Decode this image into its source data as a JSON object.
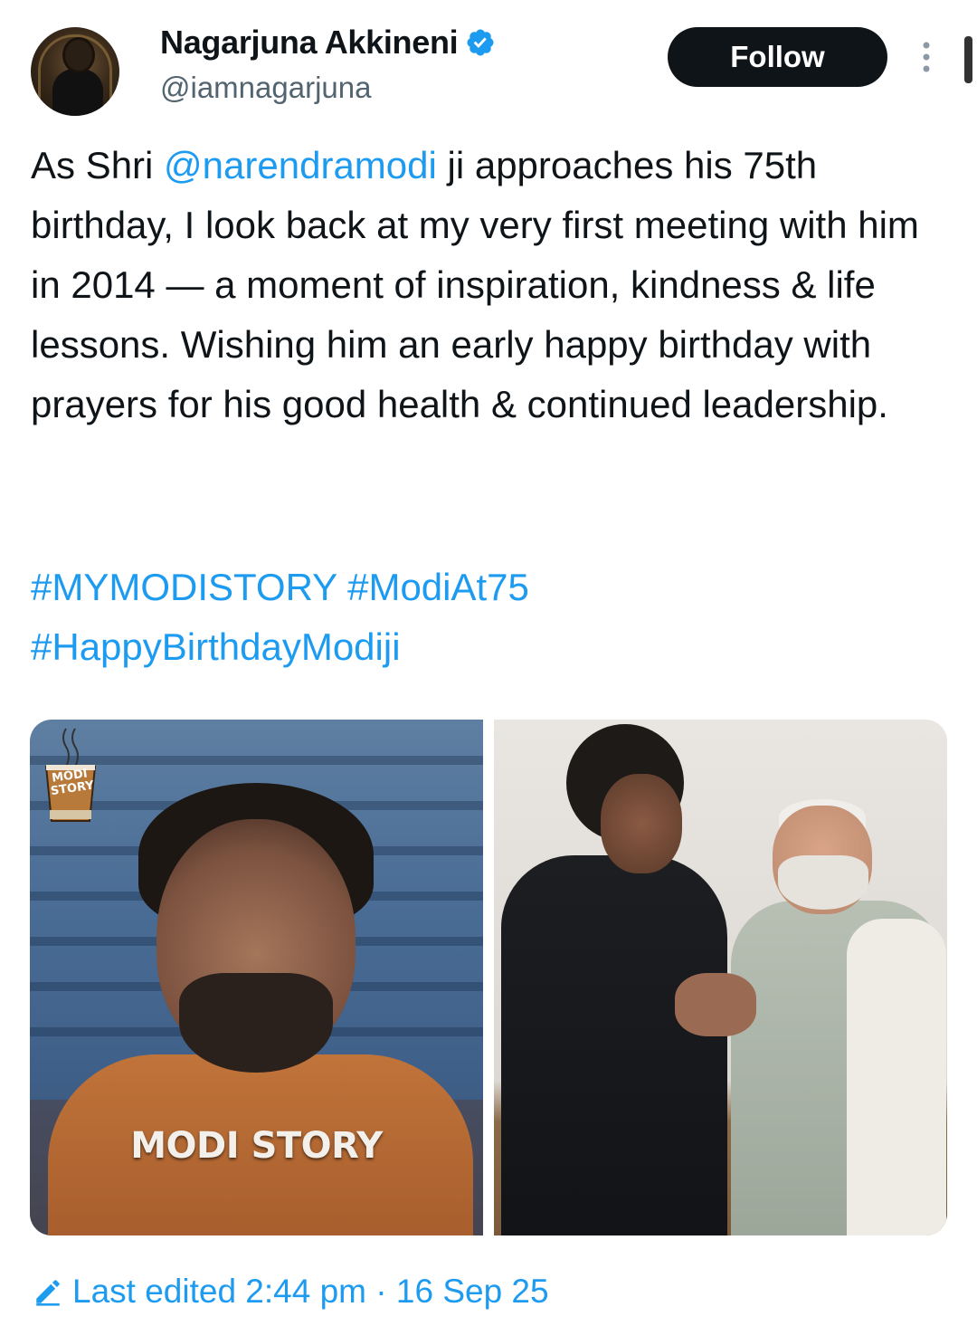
{
  "author": {
    "display_name": "Nagarjuna Akkineni",
    "handle": "@iamnagarjuna",
    "verified": true
  },
  "actions": {
    "follow_label": "Follow"
  },
  "tweet": {
    "text_prefix": "As Shri ",
    "mention": "@narendramodi",
    "text_suffix": " ji approaches his 75th birthday, I look back at my very first meeting with him in 2014 — a moment of inspiration, kindness & life lessons. Wishing him an early happy birthday with prayers for his good health & continued leadership.",
    "hashtags": [
      "#MYMODISTORY",
      "#ModiAt75",
      "#HappyBirthdayModiji"
    ]
  },
  "media": {
    "left_caption": "MODI STORY",
    "left_logo_text": "MODI STORY"
  },
  "footer": {
    "edited_text": "Last edited 2:44 pm · 16 Sep 25"
  },
  "colors": {
    "accent": "#1d9bf0",
    "text": "#0f1419",
    "secondary": "#536471",
    "follow_bg": "#0f1419"
  }
}
